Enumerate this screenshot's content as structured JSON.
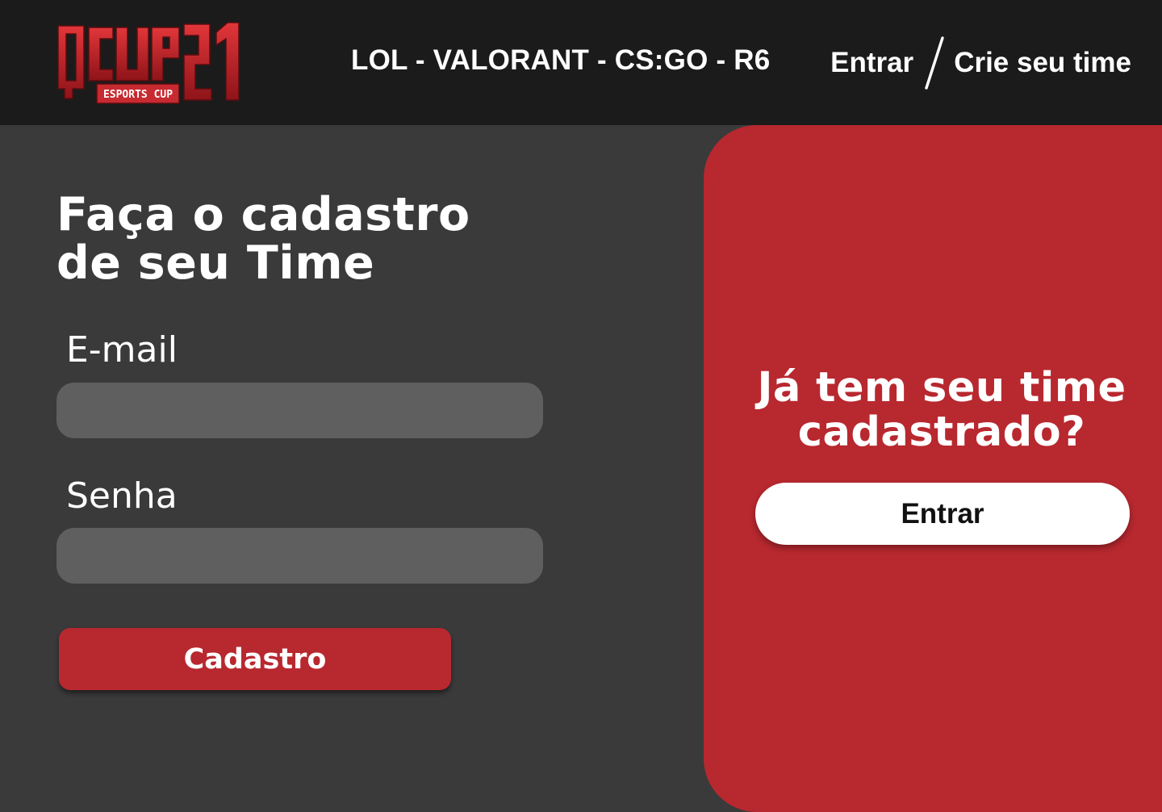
{
  "brand": {
    "logo_text": "Q CUP 21",
    "logo_tagline": "ESPORTS CUP",
    "logo_color": "#d42a2f"
  },
  "header": {
    "games": "LOL - VALORANT - CS:GO - R6",
    "login_label": "Entrar",
    "signup_label": "Crie seu time"
  },
  "form": {
    "title_line1": "Faça o cadastro",
    "title_line2": "de seu Time",
    "email_label": "E-mail",
    "email_value": "",
    "password_label": "Senha",
    "password_value": "",
    "submit_label": "Cadastro"
  },
  "side": {
    "heading_line1": "Já tem seu time",
    "heading_line2": "cadastrado?",
    "button_label": "Entrar"
  },
  "colors": {
    "header_bg": "#1b1b1b",
    "page_bg": "#3a3a3a",
    "accent": "#b8282f",
    "input_bg": "#5f5f5f"
  }
}
